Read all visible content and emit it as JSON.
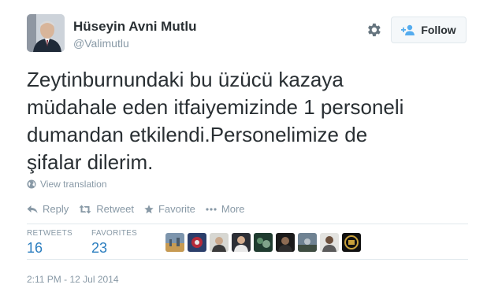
{
  "author": {
    "name": "Hüseyin Avni Mutlu",
    "handle": "@Valimutlu"
  },
  "follow_button": {
    "label": "Follow"
  },
  "tweet": {
    "text": "Zeytinburnundaki bu üzücü kazaya\nmüdahale eden itfaiyemizinde 1 personeli\ndumandan etkilendi.Personelimize de\nşifalar dilerim."
  },
  "view_translation": "View translation",
  "actions": {
    "reply": "Reply",
    "retweet": "Retweet",
    "favorite": "Favorite",
    "more": "More"
  },
  "stats": {
    "retweets_label": "RETWEETS",
    "retweets_count": "16",
    "favorites_label": "FAVORITES",
    "favorites_count": "23"
  },
  "timestamp": "2:11 PM - 12 Jul 2014",
  "colors": {
    "link_blue": "#2a7dbf",
    "meta_gray": "#8899a6",
    "text": "#292f33",
    "divider": "#e1e8ed"
  },
  "icons": {
    "settings": "gear-icon",
    "follow": "follow-person-icon",
    "translate": "globe-icon",
    "reply": "reply-icon",
    "retweet": "retweet-icon",
    "favorite": "star-icon",
    "more": "more-dots-icon"
  }
}
